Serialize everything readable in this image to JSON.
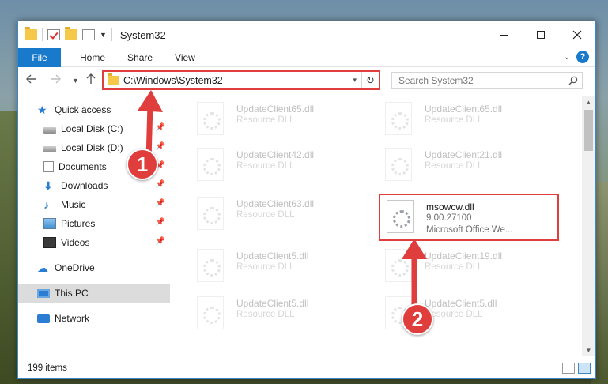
{
  "window": {
    "title": "System32",
    "controls": {
      "minimize": "–",
      "maximize": "□",
      "close": "✕"
    }
  },
  "ribbon": {
    "tabs": [
      "File",
      "Home",
      "Share",
      "View"
    ],
    "help": "?"
  },
  "address": {
    "path": "C:\\Windows\\System32",
    "search_placeholder": "Search System32"
  },
  "sidebar": {
    "items": [
      {
        "label": "Quick access",
        "icon": "star-icon",
        "pinned": false
      },
      {
        "label": "Local Disk (C:)",
        "icon": "disk-icon",
        "pinned": true
      },
      {
        "label": "Local Disk (D:)",
        "icon": "disk-icon",
        "pinned": true
      },
      {
        "label": "Documents",
        "icon": "documents-icon",
        "pinned": true
      },
      {
        "label": "Downloads",
        "icon": "download-icon",
        "pinned": true
      },
      {
        "label": "Music",
        "icon": "music-icon",
        "pinned": true
      },
      {
        "label": "Pictures",
        "icon": "pictures-icon",
        "pinned": true
      },
      {
        "label": "Videos",
        "icon": "videos-icon",
        "pinned": true
      },
      {
        "label": "OneDrive",
        "icon": "cloud-icon",
        "pinned": false
      },
      {
        "label": "This PC",
        "icon": "pc-icon",
        "pinned": false,
        "selected": true
      },
      {
        "label": "Network",
        "icon": "network-icon",
        "pinned": false
      }
    ]
  },
  "files": [
    {
      "name": "UpdateClient65.dll",
      "desc": "Resource DLL"
    },
    {
      "name": "UpdateClient65.dll",
      "desc": "Resource DLL"
    },
    {
      "name": "UpdateClient42.dll",
      "desc": "Resource DLL"
    },
    {
      "name": "UpdateClient21.dll",
      "desc": "Resource DLL"
    },
    {
      "name": "UpdateClient63.dll",
      "desc": "Resource DLL"
    },
    {
      "name": "msowcw.dll",
      "desc": "9.00.27100",
      "meta": "Microsoft Office We..."
    },
    {
      "name": "UpdateClient5.dll",
      "desc": "Resource DLL"
    },
    {
      "name": "UpdateClient19.dll",
      "desc": "Resource DLL"
    },
    {
      "name": "UpdateClient5.dll",
      "desc": "Resource DLL"
    },
    {
      "name": "UpdateClient5.dll",
      "desc": "Resource DLL"
    }
  ],
  "status": {
    "item_count": "199 items"
  },
  "annotations": {
    "step1": "1",
    "step2": "2",
    "color": "#e03d3d"
  }
}
